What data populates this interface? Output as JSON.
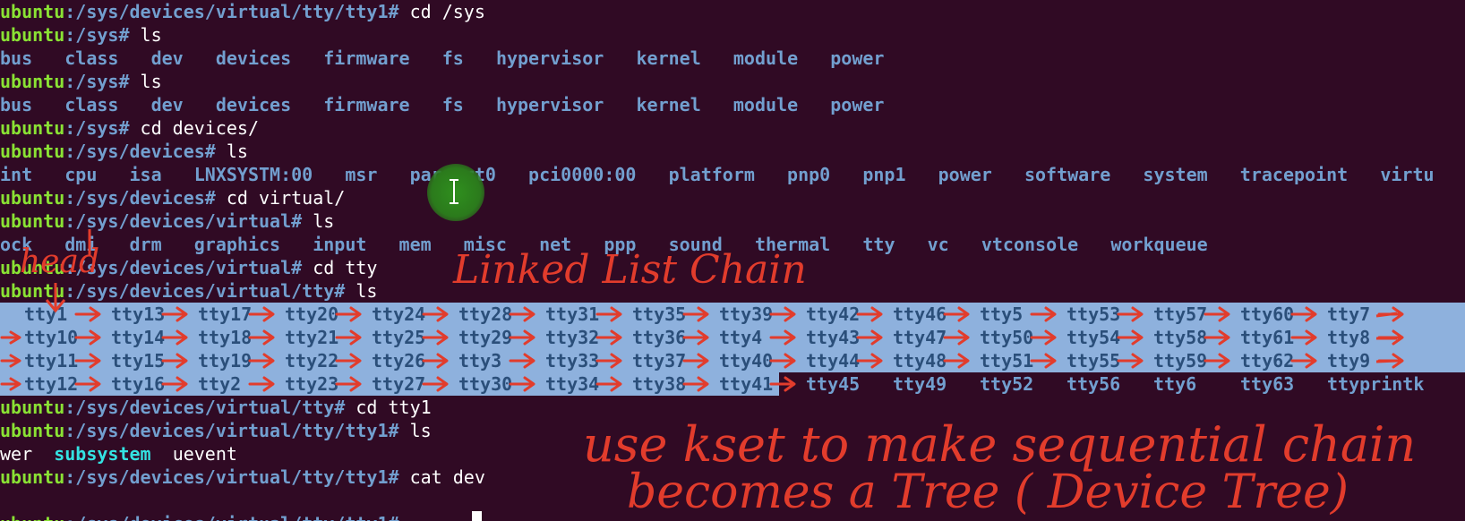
{
  "user": "ubuntu",
  "lines": [
    {
      "path": ":/sys/devices/virtual/tty/tty1#",
      "cmd": " cd /sys"
    },
    {
      "path": ":/sys#",
      "cmd": " ls"
    },
    {
      "out": [
        "bus",
        "class",
        "dev",
        "devices",
        "firmware",
        "fs",
        "hypervisor",
        "kernel",
        "module",
        "power"
      ]
    },
    {
      "path": ":/sys#",
      "cmd": " ls"
    },
    {
      "out": [
        "bus",
        "class",
        "dev",
        "devices",
        "firmware",
        "fs",
        "hypervisor",
        "kernel",
        "module",
        "power"
      ]
    },
    {
      "path": ":/sys#",
      "cmd": " cd devices/"
    },
    {
      "path": ":/sys/devices#",
      "cmd": " ls"
    },
    {
      "out": [
        "int",
        "cpu",
        "isa",
        "LNXSYSTM:00",
        "msr",
        "parport0",
        "pci0000:00",
        "platform",
        "pnp0",
        "pnp1",
        "power",
        "software",
        "system",
        "tracepoint",
        "virtu"
      ]
    },
    {
      "path": ":/sys/devices#",
      "cmd": " cd virtual/"
    },
    {
      "path": ":/sys/devices/virtual#",
      "cmd": " ls"
    },
    {
      "out": [
        "ock",
        "dmi",
        "drm",
        "graphics",
        "input",
        "mem",
        "misc",
        "net",
        "ppp",
        "sound",
        "thermal",
        "tty",
        "vc",
        "vtconsole",
        "workqueue"
      ]
    },
    {
      "path": ":/sys/devices/virtual#",
      "cmd": " cd tty"
    },
    {
      "path": ":/sys/devices/virtual/tty#",
      "cmd": " ls"
    }
  ],
  "tty_columns": [
    [
      "tty1",
      "tty10",
      "tty11",
      "tty12"
    ],
    [
      "tty13",
      "tty14",
      "tty15",
      "tty16"
    ],
    [
      "tty17",
      "tty18",
      "tty19",
      "tty2"
    ],
    [
      "tty20",
      "tty21",
      "tty22",
      "tty23"
    ],
    [
      "tty24",
      "tty25",
      "tty26",
      "tty27"
    ],
    [
      "tty28",
      "tty29",
      "tty3",
      "tty30"
    ],
    [
      "tty31",
      "tty32",
      "tty33",
      "tty34"
    ],
    [
      "tty35",
      "tty36",
      "tty37",
      "tty38"
    ],
    [
      "tty39",
      "tty4",
      "tty40",
      "tty41"
    ],
    [
      "tty42",
      "tty43",
      "tty44",
      "tty45"
    ],
    [
      "tty46",
      "tty47",
      "tty48",
      "tty49"
    ],
    [
      "tty5",
      "tty50",
      "tty51",
      "tty52"
    ],
    [
      "tty53",
      "tty54",
      "tty55",
      "tty56"
    ],
    [
      "tty57",
      "tty58",
      "tty59",
      "tty6"
    ],
    [
      "tty60",
      "tty61",
      "tty62",
      "tty63"
    ],
    [
      "tty7",
      "tty8",
      "tty9",
      "ttyprintk"
    ]
  ],
  "after_lines": [
    {
      "path": ":/sys/devices/virtual/tty#",
      "cmd": " cd tty1"
    },
    {
      "path": ":/sys/devices/virtual/tty/tty1#",
      "cmd": " ls"
    },
    {
      "out_special": [
        {
          "t": "wer",
          "c": "file"
        },
        {
          "t": "subsystem",
          "c": "link"
        },
        {
          "t": "uevent",
          "c": "file"
        }
      ]
    },
    {
      "path": ":/sys/devices/virtual/tty/tty1#",
      "cmd": " cat dev"
    },
    {
      "blank": true
    },
    {
      "path": ":/sys/devices/virtual/tty/tty1#",
      "cmd": " "
    }
  ],
  "annotations": {
    "head": "head",
    "linked_list": "Linked List Chain",
    "kset_line1": "use kset to make sequential chain",
    "kset_line2": "becomes a Tree ( Device Tree)"
  },
  "colors": {
    "background": "#300a24",
    "prompt_user": "#8ae234",
    "prompt_path": "#729fcf",
    "selection": "#8eb1dd",
    "annotation": "#e23c2c"
  }
}
